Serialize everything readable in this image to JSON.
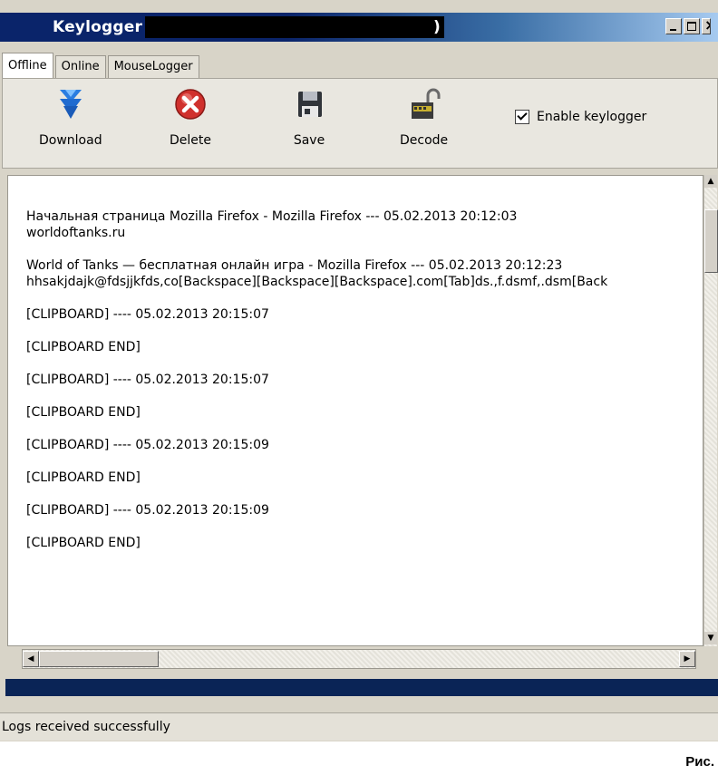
{
  "window": {
    "title": "Keylogger (",
    "title_close": ")"
  },
  "tabs": [
    {
      "label": "Offline",
      "active": true
    },
    {
      "label": "Online",
      "active": false
    },
    {
      "label": "MouseLogger",
      "active": false
    }
  ],
  "toolbar": {
    "download_label": "Download",
    "delete_label": "Delete",
    "save_label": "Save",
    "decode_label": "Decode",
    "enable_label": "Enable keylogger",
    "enable_checked": true
  },
  "log": [
    {
      "line1": "Начальная страница Mozilla Firefox - Mozilla Firefox --- 05.02.2013 20:12:03",
      "line2": "worldoftanks.ru"
    },
    {
      "line1": "World of Tanks — бесплатная онлайн игра - Mozilla Firefox --- 05.02.2013 20:12:23",
      "line2": "hhsakjdajk@fdsjjkfds,co[Backspace][Backspace][Backspace].com[Tab]ds.,f.dsmf,.dsm[Back"
    },
    {
      "line1": "[CLIPBOARD] ---- 05.02.2013 20:15:07"
    },
    {
      "line1": "[CLIPBOARD END]"
    },
    {
      "line1": "[CLIPBOARD] ---- 05.02.2013 20:15:07"
    },
    {
      "line1": "[CLIPBOARD END]"
    },
    {
      "line1": "[CLIPBOARD] ---- 05.02.2013 20:15:09"
    },
    {
      "line1": "[CLIPBOARD END]"
    },
    {
      "line1": "[CLIPBOARD] ---- 05.02.2013 20:15:09"
    },
    {
      "line1": "[CLIPBOARD END]"
    }
  ],
  "status": {
    "text": "Logs received successfully"
  },
  "caption": "Рис.",
  "colors": {
    "titlebar": "#0a246a",
    "progress": "#0a2456",
    "delete_red": "#d0312d",
    "download_blue": "#2a7de1"
  }
}
